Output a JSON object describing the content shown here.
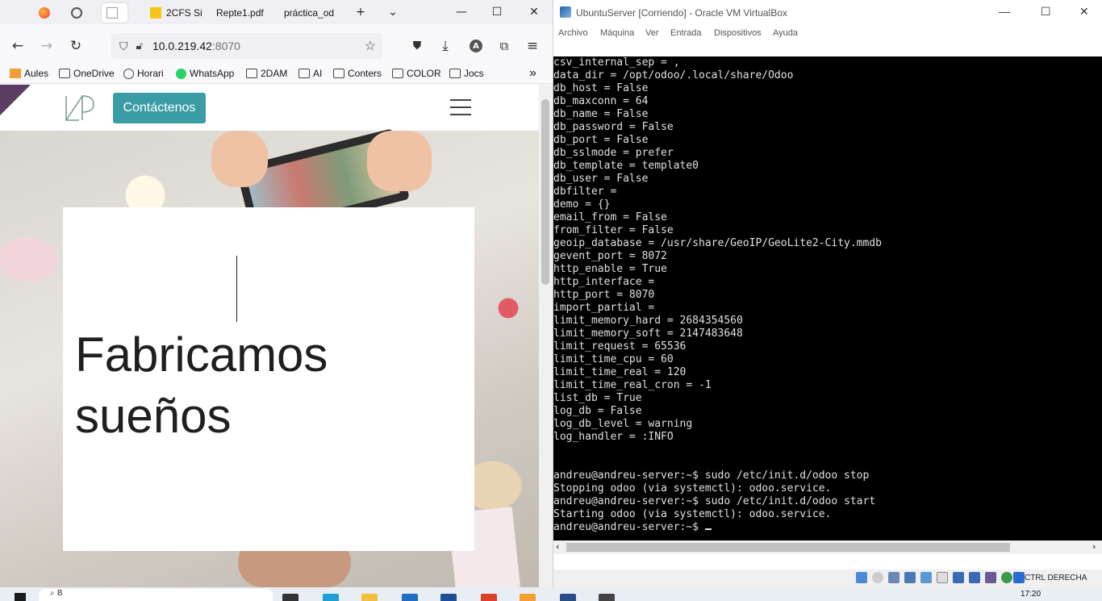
{
  "browser": {
    "tabs": [
      {
        "label": ""
      },
      {
        "label": ""
      },
      {
        "label": ""
      },
      {
        "label": "2CFS Si"
      },
      {
        "label": "Repte1.pdf"
      },
      {
        "label": "práctica_od"
      }
    ],
    "url": {
      "host": "10.0.219.42",
      "port": ":8070"
    },
    "bookmarks": [
      {
        "label": "Aules"
      },
      {
        "label": "OneDrive"
      },
      {
        "label": "Horari"
      },
      {
        "label": "WhatsApp"
      },
      {
        "label": "2DAM"
      },
      {
        "label": "AI"
      },
      {
        "label": "Conters"
      },
      {
        "label": "COLOR"
      },
      {
        "label": "Jocs"
      }
    ],
    "more_bookmarks": "»"
  },
  "site": {
    "cta_label": "Contáctenos",
    "headline_line1": "Fabricamos",
    "headline_line2": "sueños"
  },
  "vbox": {
    "title": "UbuntuServer [Corriendo] - Oracle VM VirtualBox",
    "menu": [
      "Archivo",
      "Máquina",
      "Ver",
      "Entrada",
      "Dispositivos",
      "Ayuda"
    ],
    "terminal_lines": [
      "csv_internal_sep = ,",
      "data_dir = /opt/odoo/.local/share/Odoo",
      "db_host = False",
      "db_maxconn = 64",
      "db_name = False",
      "db_password = False",
      "db_port = False",
      "db_sslmode = prefer",
      "db_template = template0",
      "db_user = False",
      "dbfilter =",
      "demo = {}",
      "email_from = False",
      "from_filter = False",
      "geoip_database = /usr/share/GeoIP/GeoLite2-City.mmdb",
      "gevent_port = 8072",
      "http_enable = True",
      "http_interface =",
      "http_port = 8070",
      "import_partial =",
      "limit_memory_hard = 2684354560",
      "limit_memory_soft = 2147483648",
      "limit_request = 65536",
      "limit_time_cpu = 60",
      "limit_time_real = 120",
      "limit_time_real_cron = -1",
      "list_db = True",
      "log_db = False",
      "log_db_level = warning",
      "log_handler = :INFO",
      "",
      "",
      "andreu@andreu-server:~$ sudo /etc/init.d/odoo stop",
      "Stopping odoo (via systemctl): odoo.service.",
      "andreu@andreu-server:~$ sudo /etc/init.d/odoo start",
      "Starting odoo (via systemctl): odoo.service.",
      "andreu@andreu-server:~$ "
    ],
    "host_key": "CTRL DERECHA"
  },
  "taskbar": {
    "search_placeholder": "B",
    "clock": "17:20"
  }
}
